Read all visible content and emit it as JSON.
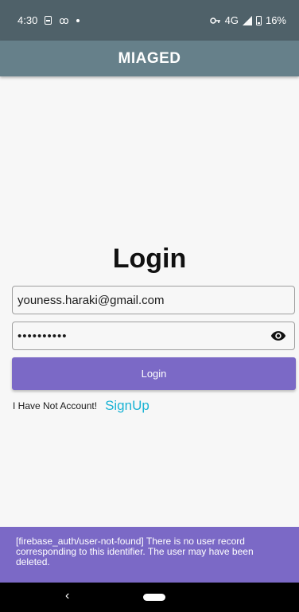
{
  "status_bar": {
    "time": "4:30",
    "icons": [
      "sim-card-icon",
      "voicemail-icon",
      "notification-dot-icon",
      "vpn-key-icon",
      "signal-icon",
      "battery-icon"
    ],
    "voicemail_glyph": "ꝏ",
    "network": "4G",
    "battery": "16%"
  },
  "app_bar": {
    "title": "MIAGED",
    "color": "#66808a"
  },
  "login": {
    "title": "Login",
    "email_value": "youness.haraki@gmail.com",
    "password_value": "••••••••••",
    "button_label": "Login",
    "signup_prompt": "I Have Not Account!",
    "signup_link": "SignUp",
    "accent_color": "#7b69c6",
    "link_color": "#1ab3d4"
  },
  "snackbar": {
    "message": "[firebase_auth/user-not-found] There is no user record corresponding to this identifier. The user may have been deleted."
  },
  "nav_bar": {
    "back_glyph": "‹"
  }
}
